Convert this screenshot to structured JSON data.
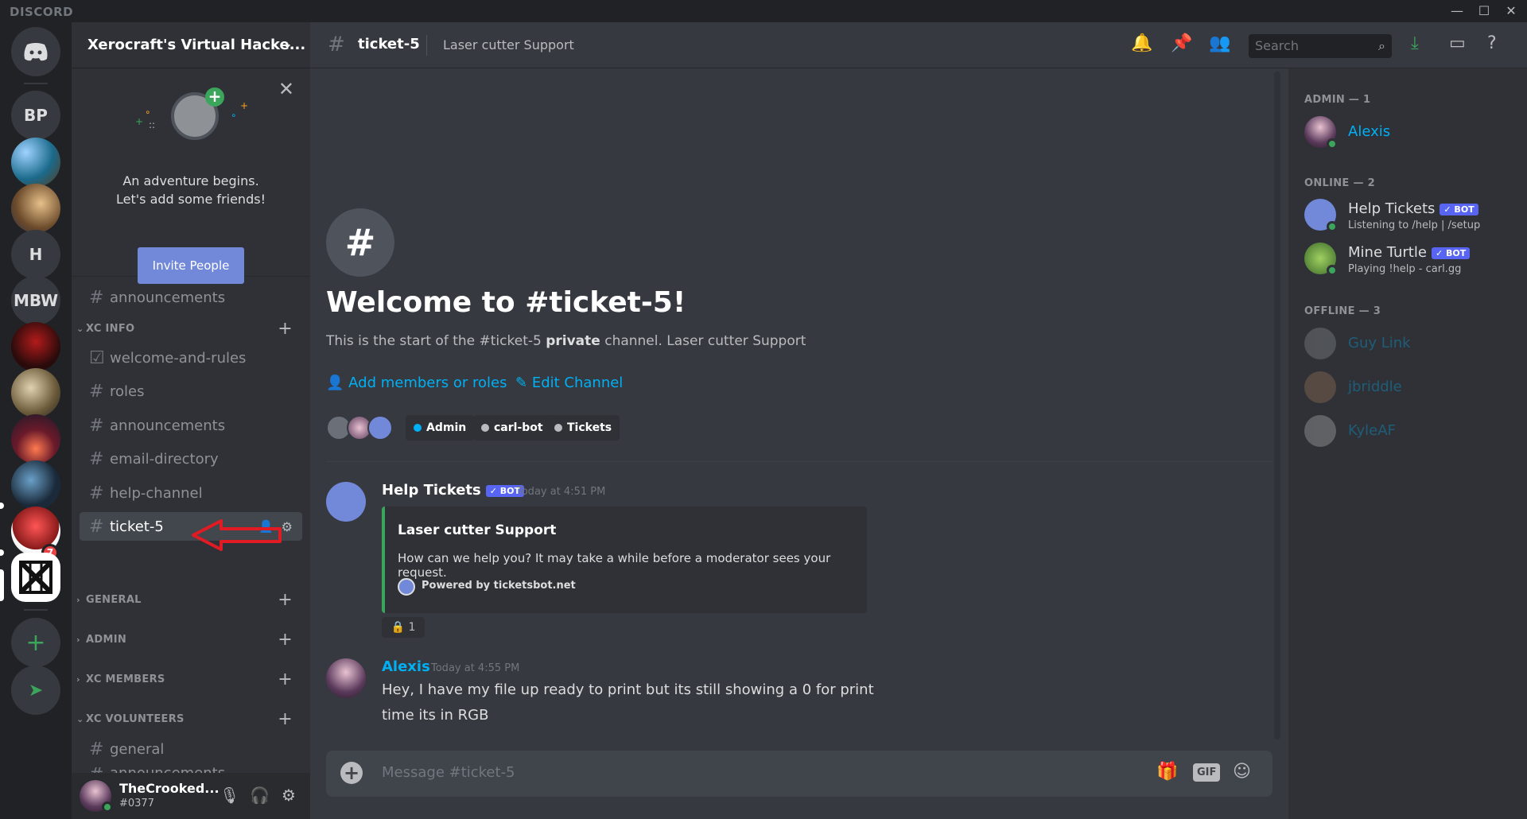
{
  "app": {
    "logo_text": "DISCORD"
  },
  "window": {
    "min": "—",
    "max": "☐",
    "close": "✕"
  },
  "rail": {
    "servers": [
      {
        "label": "BP"
      },
      {
        "label": ""
      },
      {
        "label": ""
      },
      {
        "label": "H"
      },
      {
        "label": "MBW"
      }
    ],
    "badge_count": "7",
    "add_label": "+",
    "explore_label": "➤"
  },
  "guild": {
    "name": "Xerocraft's Virtual Hacke...",
    "invite": {
      "line1": "An adventure begins.",
      "line2": "Let's add some friends!",
      "button": "Invite People"
    },
    "top_channel": "announcements",
    "categories": {
      "xc_info": "XC INFO",
      "general": "GENERAL",
      "admin": "ADMIN",
      "xc_members": "XC MEMBERS",
      "xc_volunteers": "XC VOLUNTEERS"
    },
    "xc_info_channels": [
      "welcome-and-rules",
      "roles",
      "announcements",
      "email-directory",
      "help-channel",
      "ticket-5"
    ],
    "xc_volunteer_channels": [
      "general",
      "announcements"
    ]
  },
  "user": {
    "name": "TheCrooked...",
    "discriminator": "#0377"
  },
  "header": {
    "channel": "ticket-5",
    "topic": "Laser cutter Support",
    "search_placeholder": "Search"
  },
  "welcome": {
    "title": "Welcome to #ticket-5!",
    "sub_prefix": "This is the start of the #ticket-5 ",
    "sub_bold": "private",
    "sub_suffix": " channel. Laser cutter Support",
    "add_members": "Add members or roles",
    "edit_channel": "Edit Channel",
    "roles": [
      {
        "name": "Admin",
        "color": "#00b0f4"
      },
      {
        "name": "carl-bot",
        "color": "#b9bbbe"
      },
      {
        "name": "Tickets",
        "color": "#b9bbbe"
      }
    ]
  },
  "messages": [
    {
      "author": "Help Tickets",
      "bot_tag": "✓ BOT",
      "time": "Today at 4:51 PM",
      "embed": {
        "title": "Laser cutter Support",
        "description": "How can we help you? It may take a while before a moderator sees your request.",
        "footer": "Powered by ticketsbot.net"
      },
      "reaction": {
        "emoji": "🔒",
        "count": "1"
      }
    },
    {
      "author": "Alexis",
      "time": "Today at 4:55 PM",
      "text": "Hey, I have my file up ready to print but its still showing a 0 for print time its in RGB"
    }
  ],
  "composer": {
    "placeholder": "Message #ticket-5",
    "gif_label": "GIF"
  },
  "members": {
    "admin_header": "ADMIN — 1",
    "online_header": "ONLINE — 2",
    "offline_header": "OFFLINE — 3",
    "admin": [
      {
        "name": "Alexis",
        "color": "#00b0f4"
      }
    ],
    "online": [
      {
        "name": "Help Tickets",
        "tag": "✓ BOT",
        "status": "Listening to /help | /setup"
      },
      {
        "name": "Mine Turtle",
        "tag": "✓ BOT",
        "status": "Playing !help - carl.gg"
      }
    ],
    "offline": [
      {
        "name": "Guy Link",
        "color": "#00b0f4"
      },
      {
        "name": "jbriddle",
        "color": "#00b0f4"
      },
      {
        "name": "KyleAF",
        "color": "#00b0f4"
      }
    ]
  },
  "colors": {
    "accent": "#7289da",
    "link": "#00b0f4",
    "online": "#3ba55c",
    "annotation_arrow": "#e01b24"
  }
}
